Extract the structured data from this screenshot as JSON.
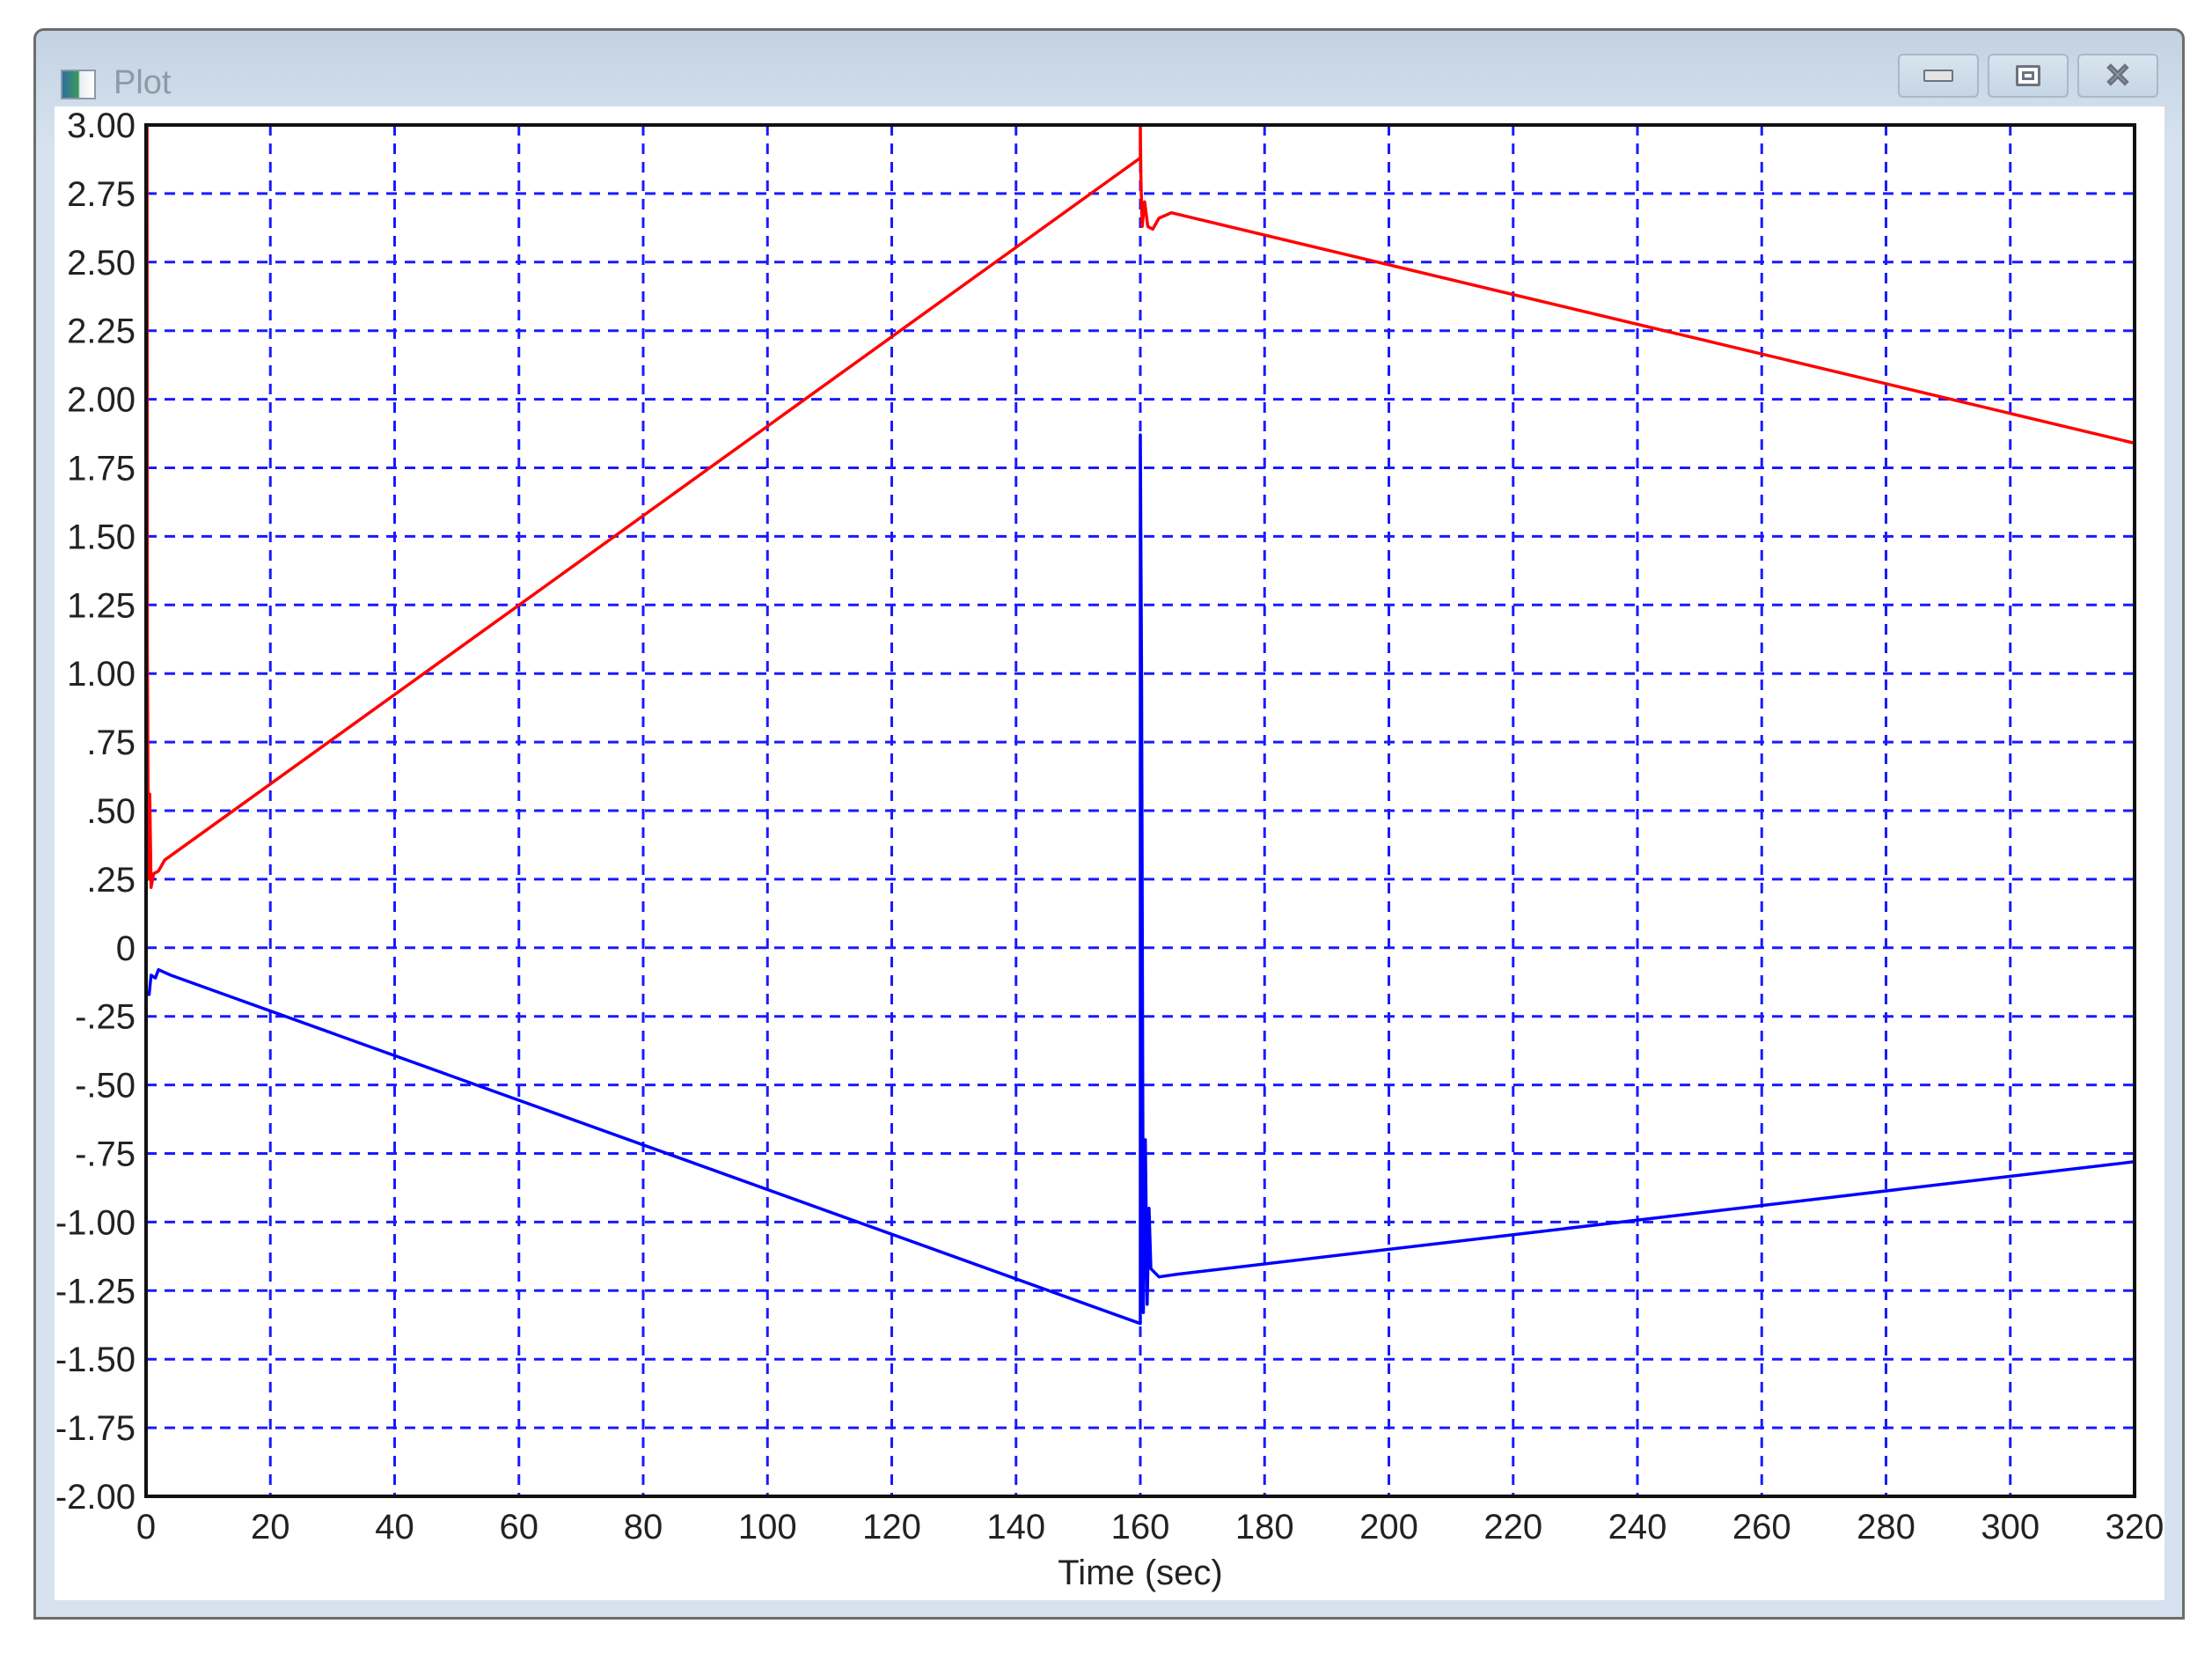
{
  "window": {
    "title": "Plot",
    "icon": "plot-app-icon",
    "buttons": [
      "minimize",
      "maximize",
      "close"
    ]
  },
  "colors": {
    "grid": "#1a1aff",
    "series_red": "#ff0000",
    "series_blue": "#0000ff",
    "axis": "#000000"
  },
  "chart_data": {
    "type": "line",
    "title": "",
    "xlabel": "Time (sec)",
    "ylabel": "",
    "xlim": [
      0,
      320
    ],
    "ylim": [
      -2,
      3
    ],
    "grid": true,
    "xticks": [
      0,
      20,
      40,
      60,
      80,
      100,
      120,
      140,
      160,
      180,
      200,
      220,
      240,
      260,
      280,
      300,
      320
    ],
    "xtick_labels": [
      "0",
      "20",
      "40",
      "60",
      "80",
      "100",
      "120",
      "140",
      "160",
      "180",
      "200",
      "220",
      "240",
      "260",
      "280",
      "300",
      "320"
    ],
    "yticks": [
      3,
      2.75,
      2.5,
      2.25,
      2,
      1.75,
      1.5,
      1.25,
      1,
      0.75,
      0.5,
      0.25,
      0,
      -0.25,
      -0.5,
      -0.75,
      -1,
      -1.25,
      -1.5,
      -1.75,
      -2
    ],
    "ytick_labels": [
      "3.00",
      "2.75",
      "2.50",
      "2.25",
      "2.00",
      "1.75",
      "1.50",
      "1.25",
      "1.00",
      ".75",
      ".50",
      ".25",
      "0",
      "-.25",
      "-.50",
      "-.75",
      "-1.00",
      "-1.25",
      "-1.50",
      "-1.75",
      "-2.00"
    ],
    "series": [
      {
        "name": "red",
        "color": "#ff0000",
        "x": [
          0,
          0,
          0.15,
          0.2,
          0.4,
          0.6,
          0.8,
          1.2,
          2,
          3,
          160,
          160,
          160.1,
          160.3,
          160.7,
          161.2,
          162,
          163,
          165,
          320
        ],
        "y": [
          0,
          3,
          3,
          1.1,
          0.25,
          0.56,
          0.22,
          0.27,
          0.28,
          0.32,
          2.88,
          3,
          2.8,
          2.63,
          2.72,
          2.63,
          2.62,
          2.66,
          2.68,
          1.84
        ]
      },
      {
        "name": "blue",
        "color": "#0000ff",
        "x": [
          0,
          0,
          0.5,
          0.8,
          1.5,
          2,
          4,
          160,
          160,
          160.2,
          160.5,
          160.8,
          161.1,
          161.4,
          161.7,
          163,
          166,
          320
        ],
        "y": [
          0,
          -0.17,
          -0.17,
          -0.1,
          -0.11,
          -0.08,
          -0.1,
          -1.37,
          1.87,
          1.0,
          -1.33,
          -0.7,
          -1.3,
          -0.95,
          -1.17,
          -1.2,
          -1.19,
          -0.78
        ]
      }
    ]
  }
}
